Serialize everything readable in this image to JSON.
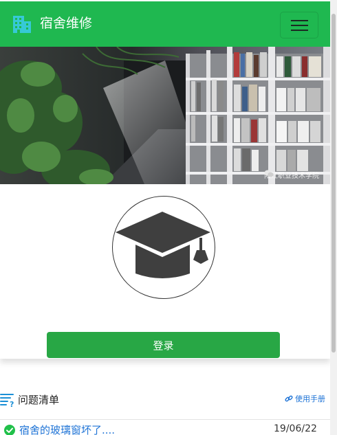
{
  "header": {
    "title": "宿舍维修",
    "brand_icon": "building-icon",
    "menu_icon": "hamburger-menu-icon",
    "accent_color": "#1fb850"
  },
  "banner": {
    "image": "library-bookshelves-photo",
    "watermark_text": "阳江职业技术学院",
    "watermark_icon": "wechat-icon"
  },
  "login": {
    "avatar_icon": "graduation-cap-icon",
    "button_label": "登录",
    "button_color": "#28a745"
  },
  "issues": {
    "title": "问题清单",
    "title_icon": "question-list-icon",
    "manual_link": "使用手册",
    "manual_icon": "link-icon",
    "items": [
      {
        "title": "宿舍的玻璃窗坏了....",
        "date": "19/06/22",
        "status_icon": "check-circle-icon",
        "status_color": "#21c04a"
      }
    ]
  }
}
